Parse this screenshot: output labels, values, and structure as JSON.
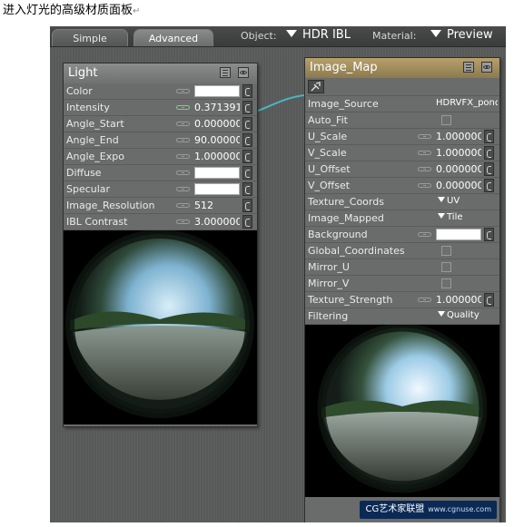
{
  "caption": "进入灯光的高级材质面板",
  "topbar": {
    "tabs": [
      {
        "label": "Simple"
      },
      {
        "label": "Advanced"
      }
    ],
    "object_label": "Object:",
    "object_value": "HDR IBL",
    "material_label": "Material:",
    "material_value": "Preview"
  },
  "light_panel": {
    "title": "Light",
    "rows": [
      {
        "label": "Color",
        "type": "color",
        "color": "#ffffff"
      },
      {
        "label": "Intensity",
        "type": "number",
        "value": "0.371391",
        "keyed": true
      },
      {
        "label": "Angle_Start",
        "type": "number",
        "value": "0.000000"
      },
      {
        "label": "Angle_End",
        "type": "number",
        "value": "90.000000"
      },
      {
        "label": "Angle_Expo",
        "type": "number",
        "value": "1.000000"
      },
      {
        "label": "Diffuse",
        "type": "color",
        "color": "#ffffff"
      },
      {
        "label": "Specular",
        "type": "color",
        "color": "#ffffff"
      },
      {
        "label": "Image_Resolution",
        "type": "number",
        "value": "512"
      },
      {
        "label": "IBL Contrast",
        "type": "number",
        "value": "3.000000"
      }
    ]
  },
  "image_map_panel": {
    "title": "Image_Map",
    "rows": [
      {
        "label": "Image_Source",
        "type": "text",
        "value": "HDRVFX_pond"
      },
      {
        "label": "Auto_Fit",
        "type": "checkbox"
      },
      {
        "label": "U_Scale",
        "type": "number",
        "value": "1.000000"
      },
      {
        "label": "V_Scale",
        "type": "number",
        "value": "1.000000"
      },
      {
        "label": "U_Offset",
        "type": "number",
        "value": "0.000000"
      },
      {
        "label": "V_Offset",
        "type": "number",
        "value": "0.000000"
      },
      {
        "label": "Texture_Coords",
        "type": "dropdown",
        "value": "UV"
      },
      {
        "label": "Image_Mapped",
        "type": "dropdown",
        "value": "Tile"
      },
      {
        "label": "Background",
        "type": "color",
        "color": "#ffffff"
      },
      {
        "label": "Global_Coordinates",
        "type": "checkbox"
      },
      {
        "label": "Mirror_U",
        "type": "checkbox"
      },
      {
        "label": "Mirror_V",
        "type": "checkbox"
      },
      {
        "label": "Texture_Strength",
        "type": "number",
        "value": "1.000000"
      },
      {
        "label": "Filtering",
        "type": "dropdown",
        "value": "Quality"
      }
    ]
  },
  "icons": [
    "list-icon",
    "eye-icon",
    "keyframe-icon",
    "spin-icon",
    "node-plug-icon"
  ],
  "colors": {
    "imap_header": "#a8925f",
    "connector": "#49b6c4",
    "accent_key": "#7fd07a"
  },
  "watermark": {
    "text": "CG艺术家联盟",
    "url": "www.cgnuse.com"
  }
}
